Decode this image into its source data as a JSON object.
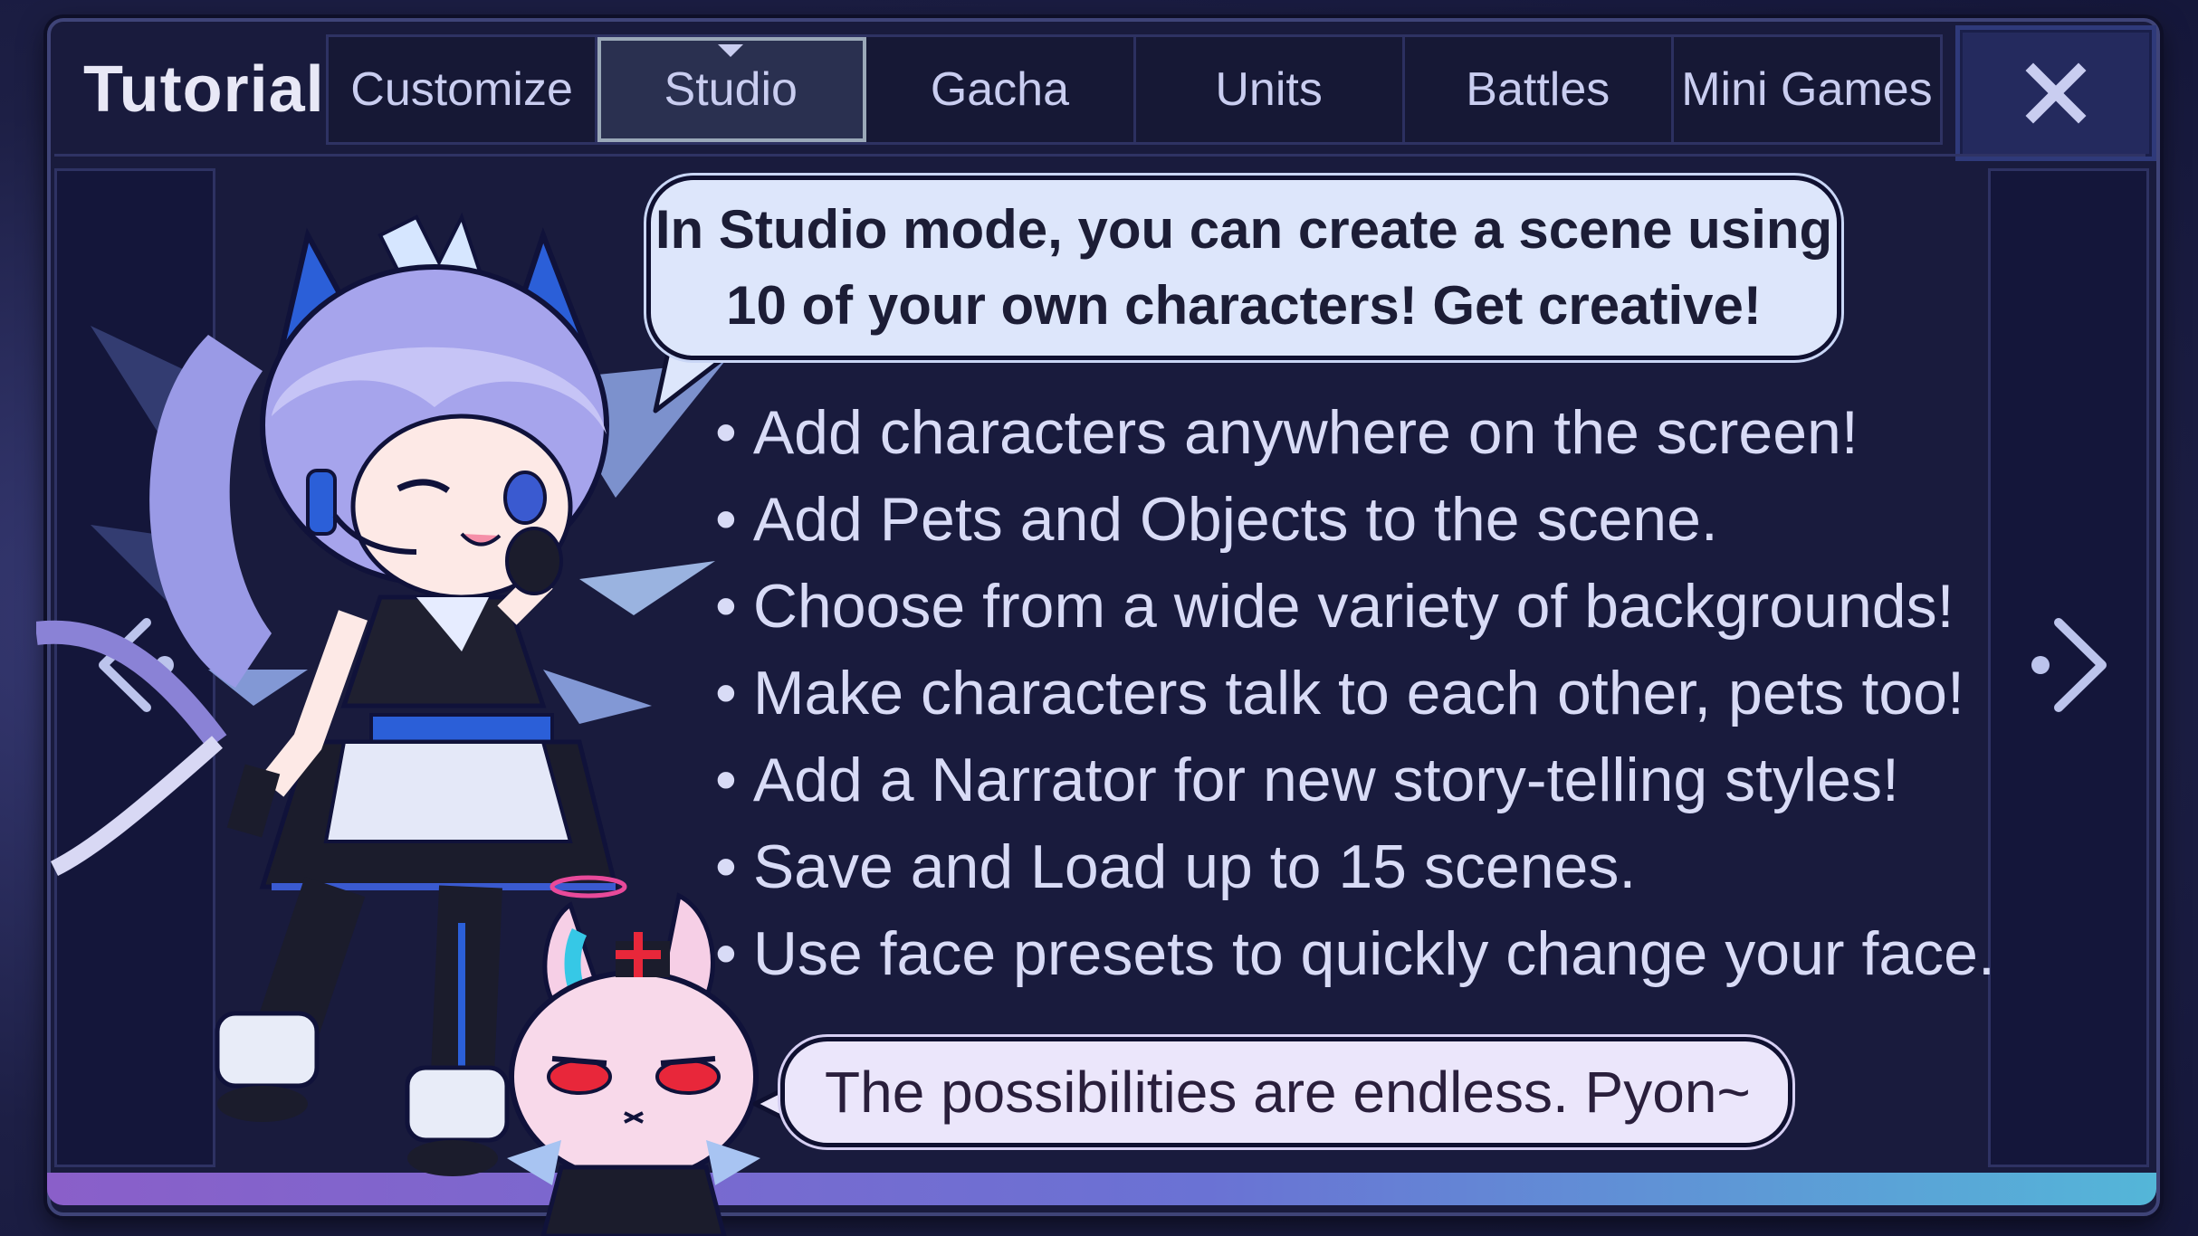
{
  "window": {
    "title": "Tutorial"
  },
  "tabs": [
    {
      "label": "Customize",
      "active": false
    },
    {
      "label": "Studio",
      "active": true
    },
    {
      "label": "Gacha",
      "active": false
    },
    {
      "label": "Units",
      "active": false
    },
    {
      "label": "Battles",
      "active": false
    },
    {
      "label": "Mini Games",
      "active": false
    }
  ],
  "close_button": {
    "icon": "close-icon",
    "label": "X"
  },
  "speech_bubble": {
    "lines": [
      "In Studio mode, you can create a scene using",
      "10 of your own characters! Get creative!"
    ]
  },
  "features": [
    "Add characters anywhere on the screen!",
    "Add Pets and Objects to the scene.",
    "Choose from a wide variety of backgrounds!",
    "Make characters talk to each other, pets too!",
    "Add a Narrator for new story-telling styles!",
    "Save and Load up to 15 scenes.",
    "Use face presets to quickly change your face."
  ],
  "pet_bubble": {
    "text": "The possibilities are endless. Pyon~"
  },
  "navigation": {
    "prev_icon": "chevron-left-icon",
    "next_icon": "chevron-right-icon"
  },
  "colors": {
    "panel_bg": "#191b3d",
    "tab_text": "#c9cdf0",
    "bubble_bg": "#dde6fb",
    "bubble2_bg": "#ebe6fb",
    "accent_gradient_start": "#8a5fc9",
    "accent_gradient_end": "#54b6d8"
  }
}
